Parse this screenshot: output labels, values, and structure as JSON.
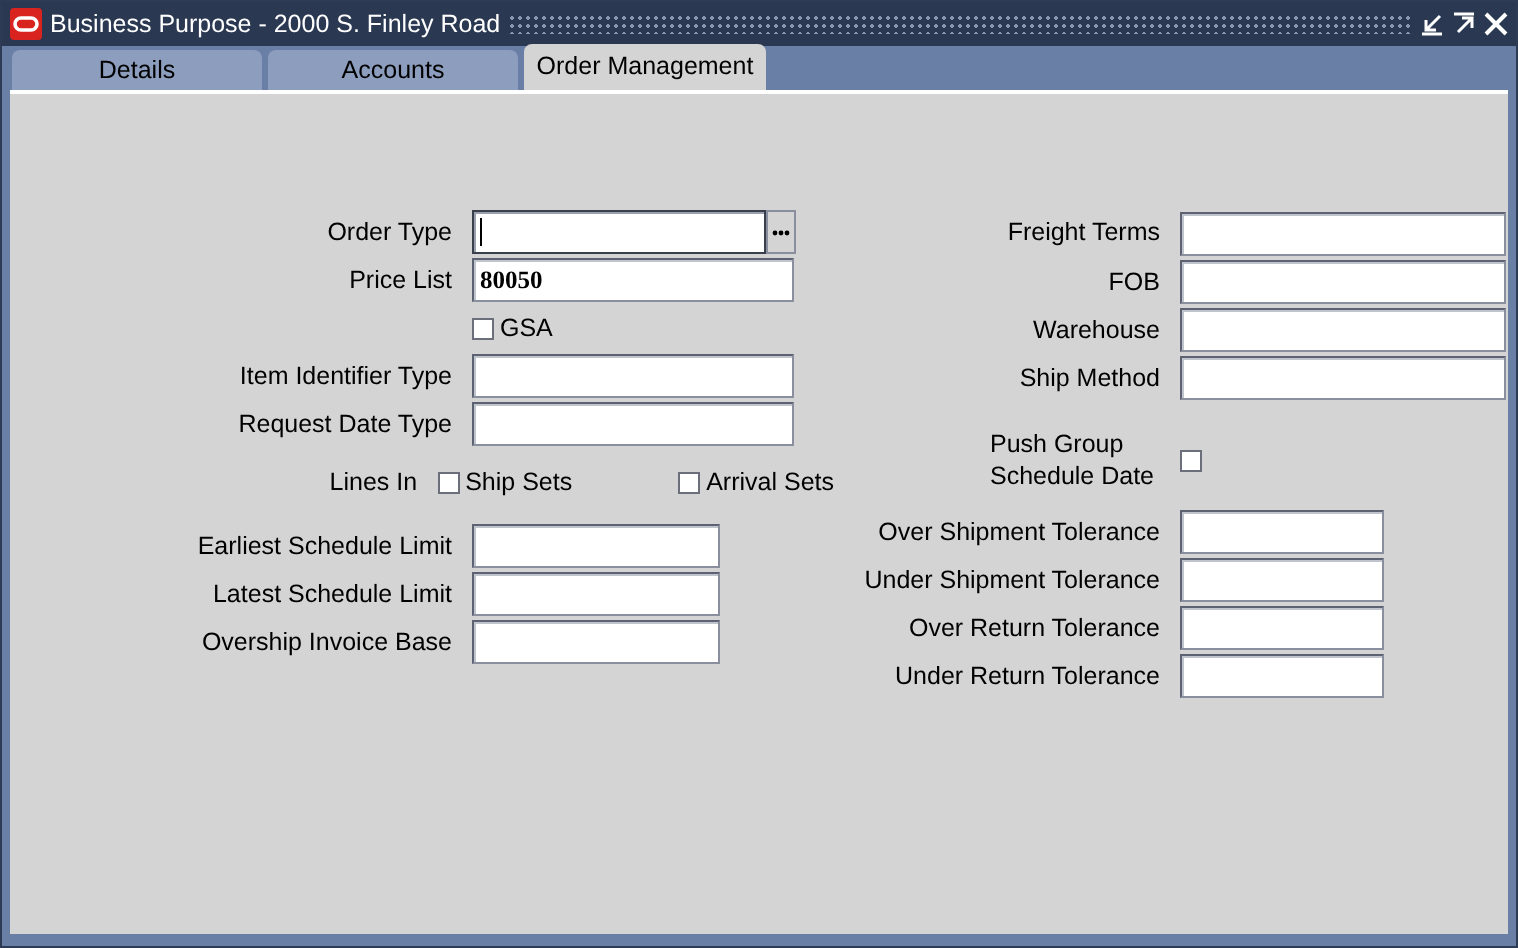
{
  "window": {
    "title": "Business Purpose - 2000 S. Finley Road"
  },
  "tabs": [
    {
      "label": "Details",
      "selected": false
    },
    {
      "label": "Accounts",
      "selected": false
    },
    {
      "label": "Order Management",
      "selected": true
    }
  ],
  "left_sections": [
    [
      {
        "kind": "lov",
        "label": "Order Type",
        "focused": true
      },
      {
        "kind": "field",
        "label": "Price List",
        "value": "80050",
        "focused": false
      },
      {
        "kind": "checkbox",
        "label": "GSA",
        "checked": false
      },
      {
        "kind": "field",
        "label": "Item Identifier Type",
        "focused": false
      },
      {
        "kind": "field",
        "label": "Request Date Type",
        "focused": false
      },
      {
        "kind": "checkgroup",
        "label": "Lines In",
        "options": [
          {
            "label": "Ship Sets",
            "checked": false
          },
          {
            "label": "Arrival Sets",
            "checked": false
          }
        ]
      }
    ],
    [
      {
        "kind": "short",
        "label": "Earliest Schedule Limit",
        "focused": false
      },
      {
        "kind": "short",
        "label": "Latest Schedule Limit",
        "focused": false
      },
      {
        "kind": "short",
        "label": "Overship Invoice Base",
        "focused": false
      }
    ]
  ],
  "right_sections": [
    [
      {
        "kind": "field",
        "label": "Freight Terms",
        "focused": false
      },
      {
        "kind": "field",
        "label": "FOB",
        "focused": false
      },
      {
        "kind": "field",
        "label": "Warehouse",
        "focused": false
      },
      {
        "kind": "field",
        "label": "Ship Method",
        "focused": false
      },
      {
        "kind": "labelcheck",
        "label": "Push Group Schedule Date",
        "checked": false
      }
    ],
    [
      {
        "kind": "short",
        "label": "Over Shipment Tolerance",
        "focused": false
      },
      {
        "kind": "short",
        "label": "Under Shipment Tolerance",
        "focused": false
      },
      {
        "kind": "short",
        "label": "Over Return Tolerance",
        "focused": false
      },
      {
        "kind": "short",
        "label": "Under Return Tolerance",
        "focused": false
      }
    ]
  ]
}
